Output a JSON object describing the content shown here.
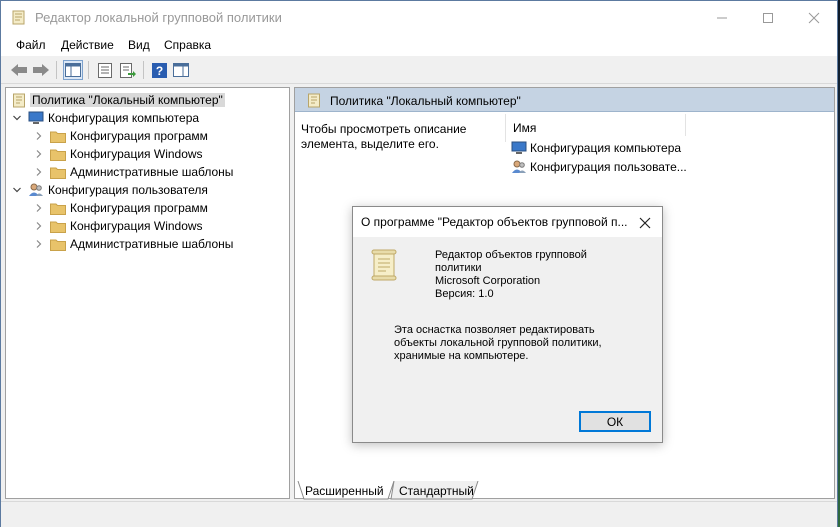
{
  "window": {
    "title": "Редактор локальной групповой политики",
    "controls": {
      "minimize": "minimize-icon",
      "maximize": "maximize-icon",
      "close": "close-icon"
    }
  },
  "menu": [
    "Файл",
    "Действие",
    "Вид",
    "Справка"
  ],
  "toolbar": {
    "icons": [
      "back-arrow-icon",
      "forward-arrow-icon",
      "show-hide-tree-icon",
      "properties-icon",
      "export-list-icon",
      "help-icon",
      "show-hide-action-pane-icon"
    ]
  },
  "tree": {
    "root": "Политика \"Локальный компьютер\"",
    "computer": {
      "label": "Конфигурация компьютера",
      "children": [
        "Конфигурация программ",
        "Конфигурация Windows",
        "Административные шаблоны"
      ]
    },
    "user": {
      "label": "Конфигурация пользователя",
      "children": [
        "Конфигурация программ",
        "Конфигурация Windows",
        "Административные шаблоны"
      ]
    }
  },
  "right_pane": {
    "header": "Политика \"Локальный компьютер\"",
    "description": "Чтобы просмотреть описание элемента, выделите его.",
    "column_name": "Имя",
    "items": [
      "Конфигурация компьютера",
      "Конфигурация пользовате..."
    ]
  },
  "tabs": [
    "Расширенный",
    "Стандартный"
  ],
  "dialog": {
    "title": "О программе \"Редактор объектов групповой п...",
    "product_line1": "Редактор объектов групповой",
    "product_line2": "политики",
    "company": "Microsoft Corporation",
    "version": "Версия: 1.0",
    "body_line1": "Эта оснастка позволяет редактировать",
    "body_line2": "объекты локальной групповой политики,",
    "body_line3": "хранимые на компьютере.",
    "ok_label": "ОК"
  },
  "colors": {
    "accent": "#0078d7",
    "pane_header": "#c5d3e3",
    "folder": "#e8c36a"
  }
}
